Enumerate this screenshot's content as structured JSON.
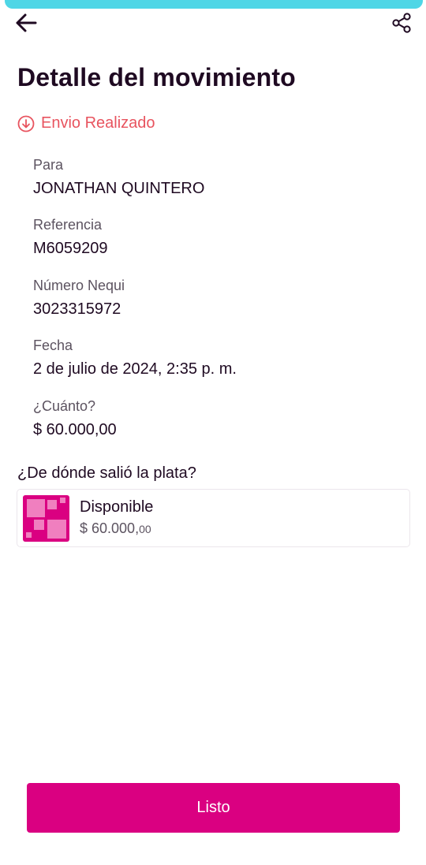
{
  "header": {
    "back_icon": "arrow-left-icon",
    "share_icon": "share-icon",
    "title": "Detalle del movimiento"
  },
  "status": {
    "icon": "arrow-down-circle-icon",
    "text": "Envio Realizado",
    "color": "#e8545f"
  },
  "details": [
    {
      "label": "Para",
      "value": "JONATHAN QUINTERO"
    },
    {
      "label": "Referencia",
      "value": "M6059209"
    },
    {
      "label": "Número Nequi",
      "value": "3023315972"
    },
    {
      "label": "Fecha",
      "value": "2 de julio de 2024, 2:35 p. m."
    },
    {
      "label": "¿Cuánto?",
      "value": "$ 60.000,00"
    }
  ],
  "source": {
    "heading": "¿De dónde salió la plata?",
    "pocket_icon": "pocket-icon",
    "name": "Disponible",
    "amount_main": "$ 60.000,",
    "amount_cents": "00"
  },
  "footer": {
    "done_label": "Listo"
  },
  "colors": {
    "accent": "#da0081",
    "top_strip": "#4fd6e6",
    "status": "#e8545f",
    "title": "#1f0a22"
  }
}
